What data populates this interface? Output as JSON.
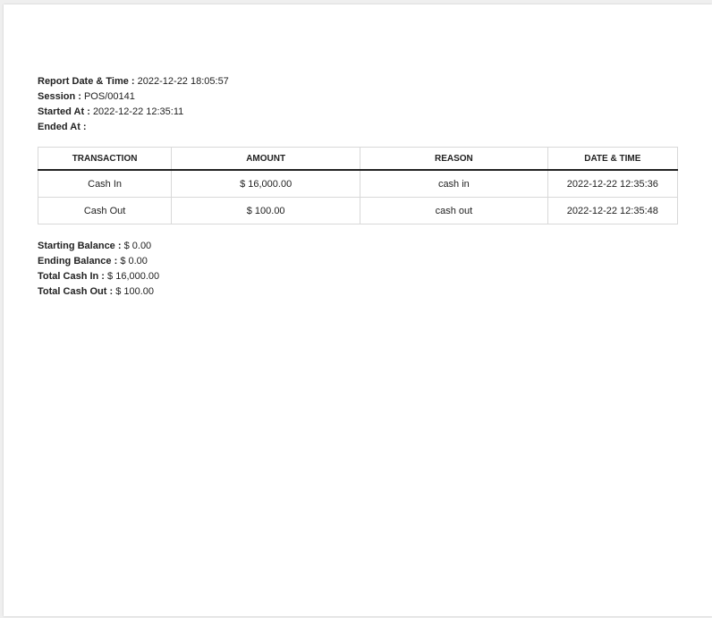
{
  "report": {
    "report_datetime_label": "Report Date & Time",
    "report_datetime_value": "2022-12-22 18:05:57",
    "session_label": "Session",
    "session_value": "POS/00141",
    "started_label": "Started At",
    "started_value": "2022-12-22 12:35:11",
    "ended_label": "Ended At",
    "ended_value": ""
  },
  "table": {
    "headers": [
      "TRANSACTION",
      "AMOUNT",
      "REASON",
      "DATE & TIME"
    ],
    "rows": [
      {
        "transaction": "Cash In",
        "amount": "$ 16,000.00",
        "reason": "cash in",
        "datetime": "2022-12-22 12:35:36"
      },
      {
        "transaction": "Cash Out",
        "amount": "$ 100.00",
        "reason": "cash out",
        "datetime": "2022-12-22 12:35:48"
      }
    ]
  },
  "summary": {
    "starting_balance_label": "Starting Balance",
    "starting_balance_value": "$ 0.00",
    "ending_balance_label": "Ending Balance",
    "ending_balance_value": "$ 0.00",
    "total_cash_in_label": "Total Cash In",
    "total_cash_in_value": "$ 16,000.00",
    "total_cash_out_label": "Total Cash Out",
    "total_cash_out_value": "$ 100.00"
  },
  "separator": " : "
}
